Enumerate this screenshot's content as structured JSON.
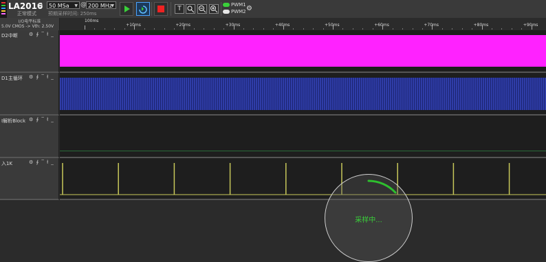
{
  "toolbar": {
    "app_title": "LA2016",
    "mode": "正常模式",
    "sample_count": "50 MSa",
    "at": "@",
    "sample_rate": "200 MHz",
    "status": "预期采样时间:  250ms",
    "pwm1": "PWM1",
    "pwm2": "PWM2",
    "icons": [
      "settings-icon",
      "play-icon",
      "loop-play-icon",
      "stop-icon",
      "text-icon",
      "zoom-fit-icon",
      "zoom-out-icon",
      "zoom-in-icon"
    ]
  },
  "io": {
    "title": "I/O电平标准",
    "voltage": "5.0V CMOS -> Vth: 2.50V"
  },
  "channels": [
    {
      "name": "D2中断",
      "controls": "⚙ ∮ ‾ ł _"
    },
    {
      "name": "D1主循环",
      "controls": "⚙ ∮ ‾ ł _"
    },
    {
      "name": "I解析Block",
      "controls": "⚙ ∮ ‾ ł _"
    },
    {
      "name": "入1K",
      "controls": "⚙ ∮ ‾ ł _"
    }
  ],
  "ruler": {
    "labels": [
      "100ms",
      "+10ms",
      "+20ms",
      "+30ms",
      "+40ms",
      "+50ms",
      "+60ms",
      "+70ms",
      "+80ms",
      "+90ms"
    ]
  },
  "overlay": {
    "text": "采样中..."
  },
  "colors": {
    "accent": "#3ad03a",
    "channel_d2": "#ff22ff",
    "channel_d1": "#28359a",
    "channel_pulse": "#c8c85a",
    "channel_block_line": "#2a6a3a"
  }
}
